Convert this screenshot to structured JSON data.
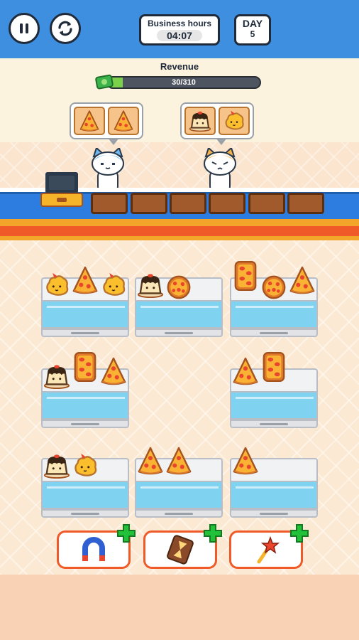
{
  "hud": {
    "business_hours_label": "Business hours",
    "business_hours_time": "04:07",
    "day_label": "DAY",
    "day_number": "5"
  },
  "revenue": {
    "label": "Revenue",
    "current": 30,
    "target": 310,
    "text": "30/310"
  },
  "customers": [
    {
      "name": "blue-cat",
      "orders": [
        "pizza-slice",
        "pizza-slice"
      ]
    },
    {
      "name": "orange-cat",
      "orders": [
        "pudding",
        "nugget"
      ]
    }
  ],
  "shelves": [
    [
      "nugget",
      "pizza-slice",
      "nugget"
    ],
    [
      "pudding",
      "pizza-round"
    ],
    [
      "pizza-square",
      "pizza-round",
      "pizza-slice"
    ],
    [
      "pudding",
      "pizza-square",
      "pizza-slice"
    ],
    [
      "pizza-slice",
      "pizza-square"
    ],
    [
      "pudding",
      "nugget"
    ],
    [
      "pizza-slice",
      "pizza-slice"
    ],
    [
      "pizza-slice"
    ]
  ],
  "boosters": [
    "magnet",
    "hourglass",
    "magic-wand"
  ],
  "colors": {
    "topbar": "#3f8fe0",
    "accent_orange": "#ef5a28",
    "revenue_fill": "#7bd24a",
    "plus_green": "#22c13a"
  }
}
